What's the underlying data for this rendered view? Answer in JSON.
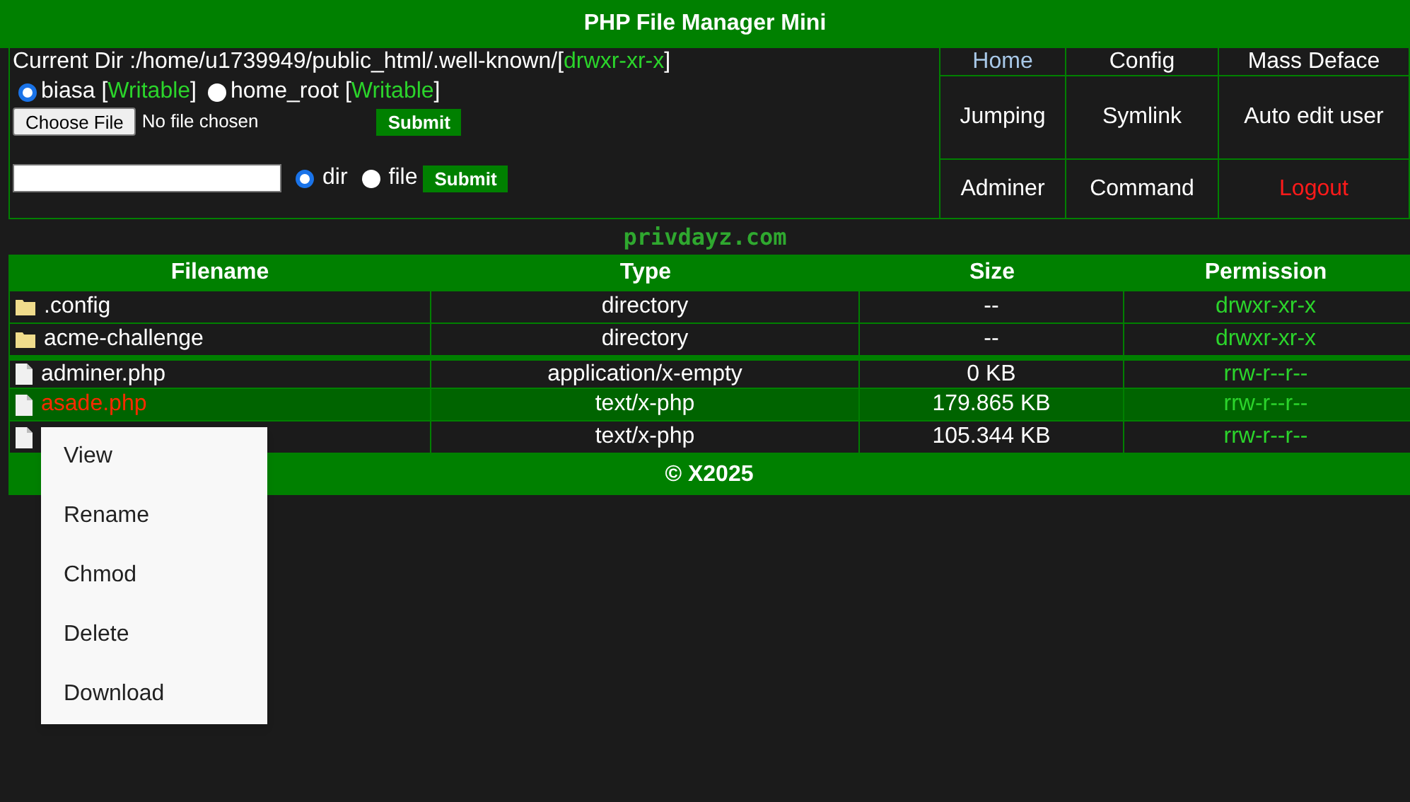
{
  "title": "PHP File Manager Mini",
  "current_dir": {
    "label": "Current Dir :/home/u1739949/public_html/.well-known/",
    "open": "[",
    "permission": "drwxr-xr-x",
    "close": "]"
  },
  "upload_modes": [
    {
      "label": "biasa",
      "open": "[",
      "status": "Writable",
      "close": "]",
      "selected": true
    },
    {
      "label": "home_root",
      "open": "[",
      "status": "Writable",
      "close": "]",
      "selected": false
    }
  ],
  "file_input": {
    "button": "Choose File",
    "value": "No file chosen"
  },
  "upload_submit": "Submit",
  "create": {
    "types": [
      {
        "label": "dir",
        "selected": true
      },
      {
        "label": "file",
        "selected": false
      }
    ],
    "submit": "Submit"
  },
  "nav": [
    {
      "label": "Home",
      "kind": "current"
    },
    {
      "label": "Config",
      "kind": "normal"
    },
    {
      "label": "Mass Deface",
      "kind": "normal"
    },
    {
      "label": "Jumping",
      "kind": "normal"
    },
    {
      "label": "Symlink",
      "kind": "normal"
    },
    {
      "label": "Auto edit user",
      "kind": "normal"
    },
    {
      "label": "Adminer",
      "kind": "normal"
    },
    {
      "label": "Command",
      "kind": "normal"
    },
    {
      "label": "Logout",
      "kind": "danger"
    }
  ],
  "brand": "privdayz.com",
  "table": {
    "columns": [
      "Filename",
      "Type",
      "Size",
      "Permission"
    ],
    "rows": [
      {
        "kind": "folder",
        "name": ".config",
        "type": "directory",
        "size": "--",
        "permission": "drwxr-xr-x",
        "selected": false
      },
      {
        "kind": "folder",
        "name": "acme-challenge",
        "type": "directory",
        "size": "--",
        "permission": "drwxr-xr-x",
        "selected": false
      },
      {
        "kind": "file",
        "name": "adminer.php",
        "type": "application/x-empty",
        "size": "0 KB",
        "permission": "rrw-r--r--",
        "selected": false
      },
      {
        "kind": "file",
        "name": "asade.php",
        "type": "text/x-php",
        "size": "179.865 KB",
        "permission": "rrw-r--r--",
        "selected": true
      },
      {
        "kind": "file",
        "type": "text/x-php",
        "size": "105.344 KB",
        "permission": "rrw-r--r--",
        "selected": false
      }
    ]
  },
  "footer": "© X2025",
  "context_menu": [
    "View",
    "Rename",
    "Chmod",
    "Delete",
    "Download"
  ]
}
